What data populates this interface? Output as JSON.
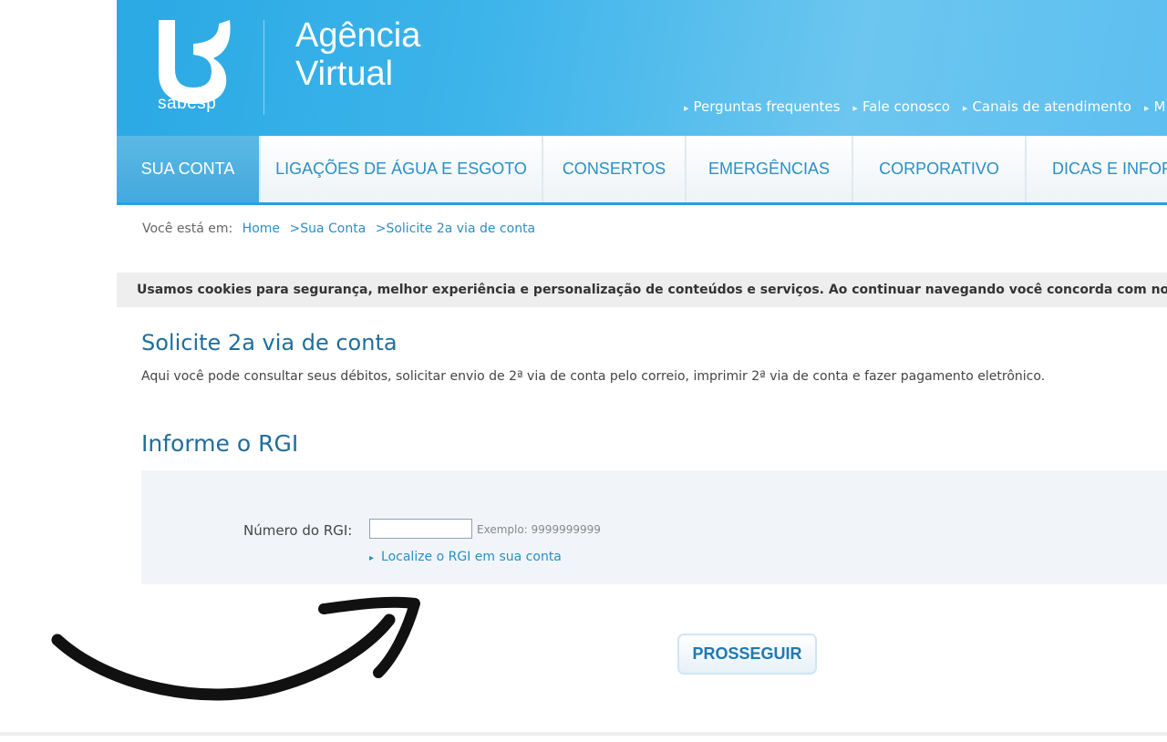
{
  "header": {
    "logo_text": "sabesp",
    "brand_line1": "Agência",
    "brand_line2": "Virtual",
    "top_links": [
      "Perguntas frequentes",
      "Fale conosco",
      "Canais de atendimento",
      "M"
    ]
  },
  "nav": {
    "items": [
      "SUA CONTA",
      "LIGAÇÕES DE ÁGUA E ESGOTO",
      "CONSERTOS",
      "EMERGÊNCIAS",
      "CORPORATIVO",
      "DICAS E INFOR"
    ],
    "active": "SUA CONTA"
  },
  "breadcrumb": {
    "prefix": "Você está em:",
    "items": [
      "Home",
      ">Sua Conta",
      ">Solicite 2a via de conta"
    ]
  },
  "cookie_notice": "Usamos cookies para segurança, melhor experiência e personalização de conteúdos e serviços. Ao continuar navegando você concorda com nossa",
  "main": {
    "title": "Solicite 2a via de conta",
    "intro": "Aqui você pode consultar seus débitos, solicitar envio de 2ª via de conta pelo correio, imprimir 2ª via de conta e fazer pagamento eletrônico.",
    "form_title": "Informe o RGI",
    "rgi_label": "Número do RGI:",
    "rgi_value": "",
    "rgi_hint": "Exemplo: 9999999999",
    "rgi_link": "Localize o RGI em sua conta",
    "submit_label": "PROSSEGUIR"
  },
  "colors": {
    "header_blue": "#2aa9e4",
    "link_blue": "#2b8fc4",
    "title_blue": "#1f6e9b"
  },
  "icons": [
    "sabesp-logo-icon",
    "arrow-bullet-icon",
    "curved-arrow-icon"
  ]
}
